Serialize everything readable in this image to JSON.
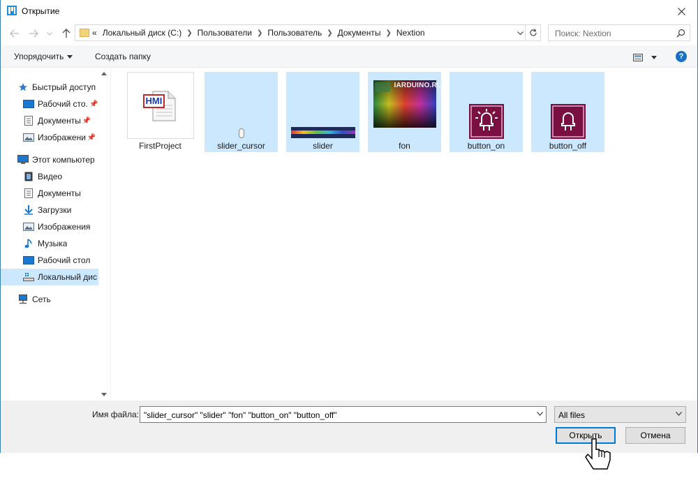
{
  "window": {
    "title": "Открытие",
    "accent_color": "#0078d7",
    "selection_color": "#cce8ff"
  },
  "nav": {
    "back_icon": "arrow-left-icon",
    "forward_icon": "arrow-right-icon",
    "recent_icon": "chevron-down-icon",
    "up_icon": "arrow-up-icon"
  },
  "address": {
    "overflow": "«",
    "crumbs": [
      "Локальный диск (C:)",
      "Пользователи",
      "Пользователь",
      "Документы",
      "Nextion"
    ]
  },
  "search": {
    "placeholder": "Поиск: Nextion"
  },
  "toolbar": {
    "organize_label": "Упорядочить",
    "new_folder_label": "Создать папку",
    "help_label": "?"
  },
  "sidebar": {
    "items": [
      {
        "label": "Быстрый доступ",
        "icon": "star-icon",
        "pinned": false
      },
      {
        "label": "Рабочий сто.",
        "icon": "desktop-icon",
        "pinned": true
      },
      {
        "label": "Документы",
        "icon": "documents-icon",
        "pinned": true
      },
      {
        "label": "Изображени",
        "icon": "pictures-icon",
        "pinned": true
      },
      {
        "label": "Этот компьютер",
        "icon": "computer-icon",
        "pinned": false
      },
      {
        "label": "Видео",
        "icon": "video-icon",
        "pinned": false
      },
      {
        "label": "Документы",
        "icon": "documents-icon",
        "pinned": false
      },
      {
        "label": "Загрузки",
        "icon": "download-icon",
        "pinned": false
      },
      {
        "label": "Изображения",
        "icon": "pictures-icon",
        "pinned": false
      },
      {
        "label": "Музыка",
        "icon": "music-icon",
        "pinned": false
      },
      {
        "label": "Рабочий стол",
        "icon": "desktop-icon",
        "pinned": false
      },
      {
        "label": "Локальный дис",
        "icon": "drive-icon",
        "pinned": false,
        "selected": true
      },
      {
        "label": "Сеть",
        "icon": "network-icon",
        "pinned": false
      }
    ]
  },
  "files": [
    {
      "name": "FirstProject",
      "type": "hmi-file",
      "selected": false,
      "badge": "HMI"
    },
    {
      "name": "slider_cursor",
      "type": "image",
      "selected": true
    },
    {
      "name": "slider",
      "type": "image",
      "selected": true
    },
    {
      "name": "fon",
      "type": "image",
      "selected": true,
      "watermark": "IARDUINO.RU"
    },
    {
      "name": "button_on",
      "type": "image",
      "selected": true
    },
    {
      "name": "button_off",
      "type": "image",
      "selected": true
    }
  ],
  "footer": {
    "filename_label": "Имя файла:",
    "filename_value": "\"slider_cursor\" \"slider\" \"fon\" \"button_on\" \"button_off\"",
    "filetype_value": "All files",
    "open_label": "Открыть",
    "cancel_label": "Отмена"
  }
}
